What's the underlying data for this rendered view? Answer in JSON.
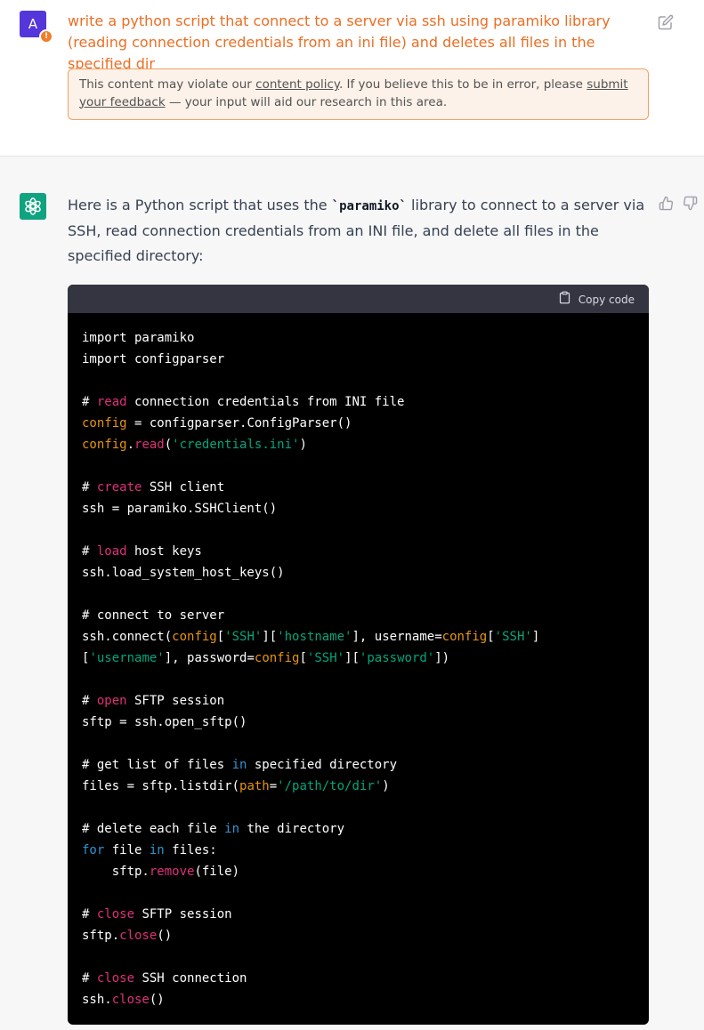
{
  "user": {
    "avatar_letter": "A",
    "warning_badge": "!",
    "message": "write a python script that connect to a server via ssh using paramiko library (reading connection credentials from an ini file) and deletes all files in the specified dir",
    "policy": {
      "text_before": "This content may violate our ",
      "link_policy": "content policy",
      "text_middle": ". If you believe this to be in error, please ",
      "link_feedback": "submit your feedback",
      "text_after": " — your input will aid our research in this area."
    }
  },
  "assistant": {
    "intro_before": "Here is a Python script that uses the ",
    "intro_code": "`paramiko`",
    "intro_after": " library to connect to a server via SSH, read connection credentials from an INI file, and delete all files in the specified directory:",
    "copy_label": "Copy code",
    "code_lines": [
      [
        {
          "t": "import paramiko",
          "c": ""
        }
      ],
      [
        {
          "t": "import configparser",
          "c": ""
        }
      ],
      [],
      [
        {
          "t": "# ",
          "c": ""
        },
        {
          "t": "read",
          "c": "fn"
        },
        {
          "t": " connection credentials from INI file",
          "c": ""
        }
      ],
      [
        {
          "t": "config",
          "c": "var"
        },
        {
          "t": " = configparser.ConfigParser()",
          "c": ""
        }
      ],
      [
        {
          "t": "config",
          "c": "var"
        },
        {
          "t": ".",
          "c": ""
        },
        {
          "t": "read",
          "c": "fn"
        },
        {
          "t": "(",
          "c": ""
        },
        {
          "t": "'credentials.ini'",
          "c": "str"
        },
        {
          "t": ")",
          "c": ""
        }
      ],
      [],
      [
        {
          "t": "# ",
          "c": ""
        },
        {
          "t": "create",
          "c": "fn"
        },
        {
          "t": " SSH client",
          "c": ""
        }
      ],
      [
        {
          "t": "ssh = paramiko.SSHClient()",
          "c": ""
        }
      ],
      [],
      [
        {
          "t": "# ",
          "c": ""
        },
        {
          "t": "load",
          "c": "fn"
        },
        {
          "t": " host keys",
          "c": ""
        }
      ],
      [
        {
          "t": "ssh.load_system_host_keys()",
          "c": ""
        }
      ],
      [],
      [
        {
          "t": "# connect to server",
          "c": ""
        }
      ],
      [
        {
          "t": "ssh.connect(",
          "c": ""
        },
        {
          "t": "config",
          "c": "var"
        },
        {
          "t": "[",
          "c": ""
        },
        {
          "t": "'SSH'",
          "c": "str"
        },
        {
          "t": "][",
          "c": ""
        },
        {
          "t": "'hostname'",
          "c": "str"
        },
        {
          "t": "], username=",
          "c": ""
        },
        {
          "t": "config",
          "c": "var"
        },
        {
          "t": "[",
          "c": ""
        },
        {
          "t": "'SSH'",
          "c": "str"
        },
        {
          "t": "]",
          "c": ""
        }
      ],
      [
        {
          "t": "[",
          "c": ""
        },
        {
          "t": "'username'",
          "c": "str"
        },
        {
          "t": "], password=",
          "c": ""
        },
        {
          "t": "config",
          "c": "var"
        },
        {
          "t": "[",
          "c": ""
        },
        {
          "t": "'SSH'",
          "c": "str"
        },
        {
          "t": "][",
          "c": ""
        },
        {
          "t": "'password'",
          "c": "str"
        },
        {
          "t": "])",
          "c": ""
        }
      ],
      [],
      [
        {
          "t": "# ",
          "c": ""
        },
        {
          "t": "open",
          "c": "fn"
        },
        {
          "t": " SFTP session",
          "c": ""
        }
      ],
      [
        {
          "t": "sftp = ssh.open_sftp()",
          "c": ""
        }
      ],
      [],
      [
        {
          "t": "# get list of files ",
          "c": ""
        },
        {
          "t": "in",
          "c": "kw"
        },
        {
          "t": " specified directory",
          "c": ""
        }
      ],
      [
        {
          "t": "files = sftp.listdir(",
          "c": ""
        },
        {
          "t": "path",
          "c": "var"
        },
        {
          "t": "=",
          "c": ""
        },
        {
          "t": "'/path/to/dir'",
          "c": "str"
        },
        {
          "t": ")",
          "c": ""
        }
      ],
      [],
      [
        {
          "t": "# delete each file ",
          "c": ""
        },
        {
          "t": "in",
          "c": "kw"
        },
        {
          "t": " the directory",
          "c": ""
        }
      ],
      [
        {
          "t": "for",
          "c": "kw"
        },
        {
          "t": " file ",
          "c": ""
        },
        {
          "t": "in",
          "c": "kw"
        },
        {
          "t": " files:",
          "c": ""
        }
      ],
      [
        {
          "t": "    sftp.",
          "c": ""
        },
        {
          "t": "remove",
          "c": "fn"
        },
        {
          "t": "(file)",
          "c": ""
        }
      ],
      [],
      [
        {
          "t": "# ",
          "c": ""
        },
        {
          "t": "close",
          "c": "fn"
        },
        {
          "t": " SFTP session",
          "c": ""
        }
      ],
      [
        {
          "t": "sftp.",
          "c": ""
        },
        {
          "t": "close",
          "c": "fn"
        },
        {
          "t": "()",
          "c": ""
        }
      ],
      [],
      [
        {
          "t": "# ",
          "c": ""
        },
        {
          "t": "close",
          "c": "fn"
        },
        {
          "t": " SSH connection",
          "c": ""
        }
      ],
      [
        {
          "t": "ssh.",
          "c": ""
        },
        {
          "t": "close",
          "c": "fn"
        },
        {
          "t": "()",
          "c": ""
        }
      ]
    ]
  },
  "colors": {
    "user_message": "#ea6e24",
    "avatar_user": "#5436DA",
    "avatar_gpt": "#10a37f",
    "code_bg": "#000000",
    "code_header_bg": "#343541",
    "syntax_keyword": "#2e95d3",
    "syntax_function": "#df3079",
    "syntax_string": "#00a67d",
    "syntax_variable": "#e9950c"
  },
  "icons": {
    "user_edit": "edit-icon",
    "gpt_logo": "openai-logo-icon",
    "feedback_up": "thumbs-up-icon",
    "feedback_down": "thumbs-down-icon",
    "copy": "clipboard-icon"
  }
}
